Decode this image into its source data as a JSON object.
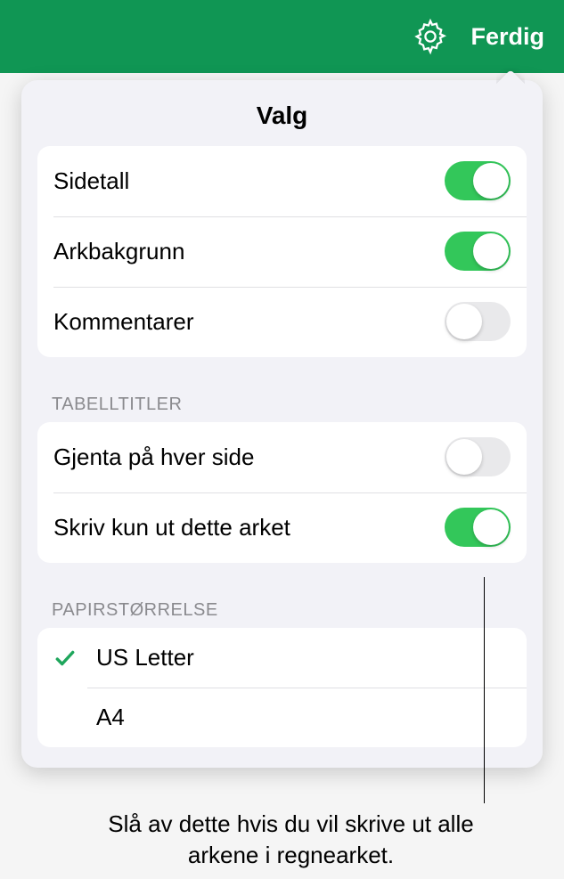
{
  "header": {
    "done": "Ferdig"
  },
  "popover": {
    "title": "Valg",
    "options": {
      "page_numbers": {
        "label": "Sidetall",
        "on": true
      },
      "sheet_background": {
        "label": "Arkbakgrunn",
        "on": true
      },
      "comments": {
        "label": "Kommentarer",
        "on": false
      }
    },
    "table_titles": {
      "header": "TABELLTITLER",
      "repeat": {
        "label": "Gjenta på hver side",
        "on": false
      },
      "this_sheet_only": {
        "label": "Skriv kun ut dette arket",
        "on": true
      }
    },
    "paper_size": {
      "header": "PAPIRSTØRRELSE",
      "items": [
        {
          "label": "US Letter",
          "selected": true
        },
        {
          "label": "A4",
          "selected": false
        }
      ]
    }
  },
  "callout": "Slå av dette hvis du vil skrive ut alle arkene i regnearket."
}
